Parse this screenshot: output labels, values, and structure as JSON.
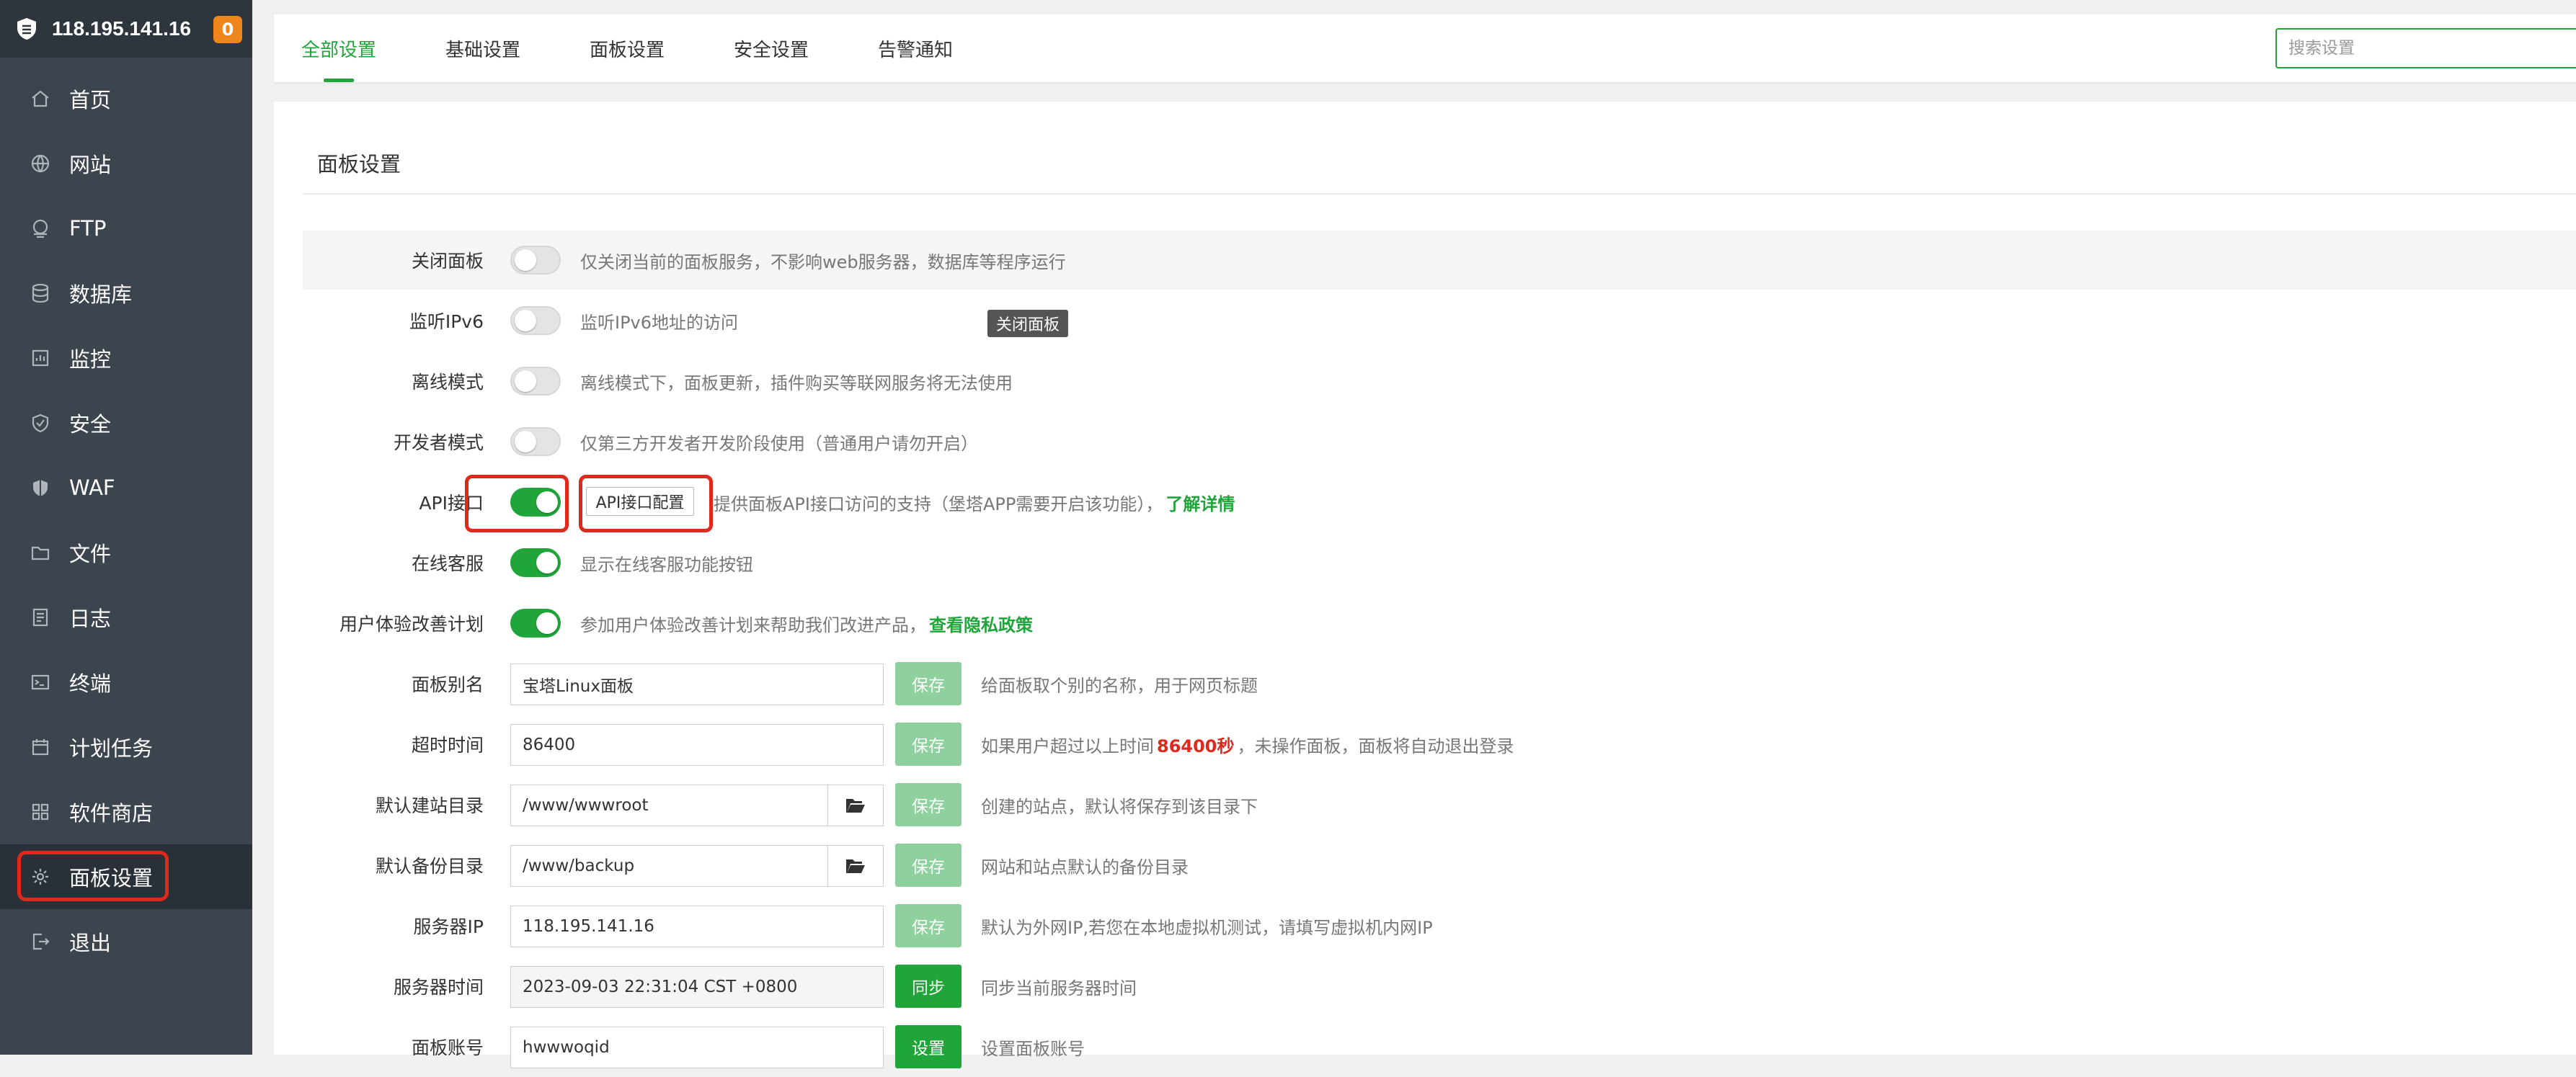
{
  "sidebar": {
    "server_ip": "118.195.141.16",
    "notification_count": "0",
    "items": [
      {
        "label": "首页",
        "icon": "home-icon"
      },
      {
        "label": "网站",
        "icon": "globe-icon"
      },
      {
        "label": "FTP",
        "icon": "ftp-icon"
      },
      {
        "label": "数据库",
        "icon": "database-icon"
      },
      {
        "label": "监控",
        "icon": "monitor-icon"
      },
      {
        "label": "安全",
        "icon": "shield-check-icon"
      },
      {
        "label": "WAF",
        "icon": "waf-shield-icon"
      },
      {
        "label": "文件",
        "icon": "folder-icon"
      },
      {
        "label": "日志",
        "icon": "log-icon"
      },
      {
        "label": "终端",
        "icon": "terminal-icon"
      },
      {
        "label": "计划任务",
        "icon": "calendar-icon"
      },
      {
        "label": "软件商店",
        "icon": "apps-grid-icon"
      },
      {
        "label": "面板设置",
        "icon": "gear-icon",
        "active": true
      },
      {
        "label": "退出",
        "icon": "logout-icon"
      }
    ]
  },
  "tabs": [
    {
      "label": "全部设置",
      "active": true
    },
    {
      "label": "基础设置"
    },
    {
      "label": "面板设置"
    },
    {
      "label": "安全设置"
    },
    {
      "label": "告警通知"
    }
  ],
  "search": {
    "placeholder": "搜索设置",
    "value": ""
  },
  "section": {
    "title": "面板设置"
  },
  "tooltip": "关闭面板",
  "settings": {
    "close_panel": {
      "label": "关闭面板",
      "enabled": false,
      "desc": "仅关闭当前的面板服务，不影响web服务器，数据库等程序运行"
    },
    "ipv6": {
      "label": "监听IPv6",
      "enabled": false,
      "desc": "监听IPv6地址的访问"
    },
    "offline": {
      "label": "离线模式",
      "enabled": false,
      "desc": "离线模式下，面板更新，插件购买等联网服务将无法使用"
    },
    "developer": {
      "label": "开发者模式",
      "enabled": false,
      "desc": "仅第三方开发者开发阶段使用（普通用户请勿开启）"
    },
    "api": {
      "label": "API接口",
      "enabled": true,
      "button": "API接口配置",
      "desc": "提供面板API接口访问的支持（堡塔APP需要开启该功能），",
      "link": "了解详情"
    },
    "online_service": {
      "label": "在线客服",
      "enabled": true,
      "desc": "显示在线客服功能按钮"
    },
    "ux_plan": {
      "label": "用户体验改善计划",
      "enabled": true,
      "desc": "参加用户体验改善计划来帮助我们改进产品，",
      "link": "查看隐私政策"
    },
    "alias": {
      "label": "面板别名",
      "value": "宝塔Linux面板",
      "button": "保存",
      "desc": "给面板取个别的名称，用于网页标题"
    },
    "timeout": {
      "label": "超时时间",
      "value": "86400",
      "button": "保存",
      "desc_prefix": "如果用户超过以上时间",
      "desc_highlight": "86400秒",
      "desc_suffix": "，未操作面板，面板将自动退出登录"
    },
    "site_dir": {
      "label": "默认建站目录",
      "value": "/www/wwwroot",
      "button": "保存",
      "desc": "创建的站点，默认将保存到该目录下"
    },
    "backup_dir": {
      "label": "默认备份目录",
      "value": "/www/backup",
      "button": "保存",
      "desc": "网站和站点默认的备份目录"
    },
    "server_ip": {
      "label": "服务器IP",
      "value": "118.195.141.16",
      "button": "保存",
      "desc": "默认为外网IP,若您在本地虚拟机测试，请填写虚拟机内网IP"
    },
    "server_time": {
      "label": "服务器时间",
      "value": "2023-09-03 22:31:04 CST +0800",
      "button": "同步",
      "desc": "同步当前服务器时间"
    },
    "panel_account": {
      "label": "面板账号",
      "value": "hwwwoqid",
      "button": "设置",
      "desc": "设置面板账号"
    }
  },
  "colors": {
    "accent": "#20a53a",
    "sidebar_bg": "#3c444d",
    "annotation_red": "#e0281d",
    "badge_orange": "#f0861b"
  }
}
